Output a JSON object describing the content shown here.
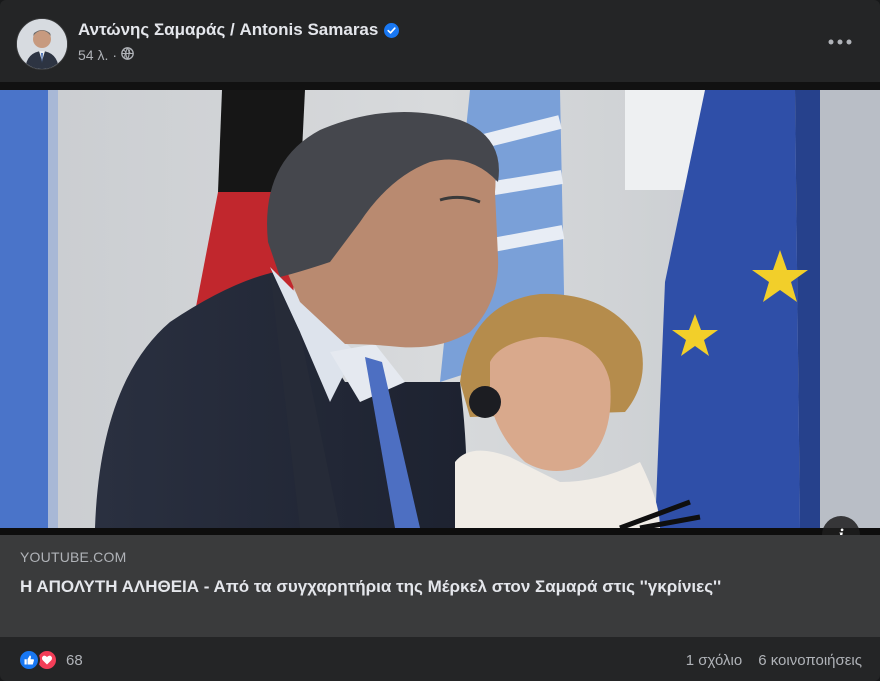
{
  "post": {
    "author": "Αντώνης Σαμαράς / Antonis Samaras",
    "time": "54 λ.",
    "separator": "·"
  },
  "media": {
    "info_label": "i"
  },
  "link": {
    "domain": "YOUTUBE.COM",
    "title": "Η ΑΠΟΛΥΤΗ ΑΛΗΘΕΙΑ - Από τα συγχαρητήρια της Μέρκελ στον Σαμαρά στις ''γκρίνιες''"
  },
  "footer": {
    "reaction_count": "68",
    "comments": "1 σχόλιο",
    "shares": "6 κοινοποιήσεις"
  },
  "icons": {
    "verified": "verified-badge-icon",
    "privacy": "globe-icon",
    "more": "more-options-icon",
    "info": "info-icon",
    "like": "like-icon",
    "love": "love-icon"
  },
  "colors": {
    "card_bg": "#242526",
    "link_bg": "#3a3b3c",
    "text_primary": "#e4e6eb",
    "text_secondary": "#b0b3b8",
    "verified_blue": "#1877f2",
    "love_red": "#f33e58"
  }
}
